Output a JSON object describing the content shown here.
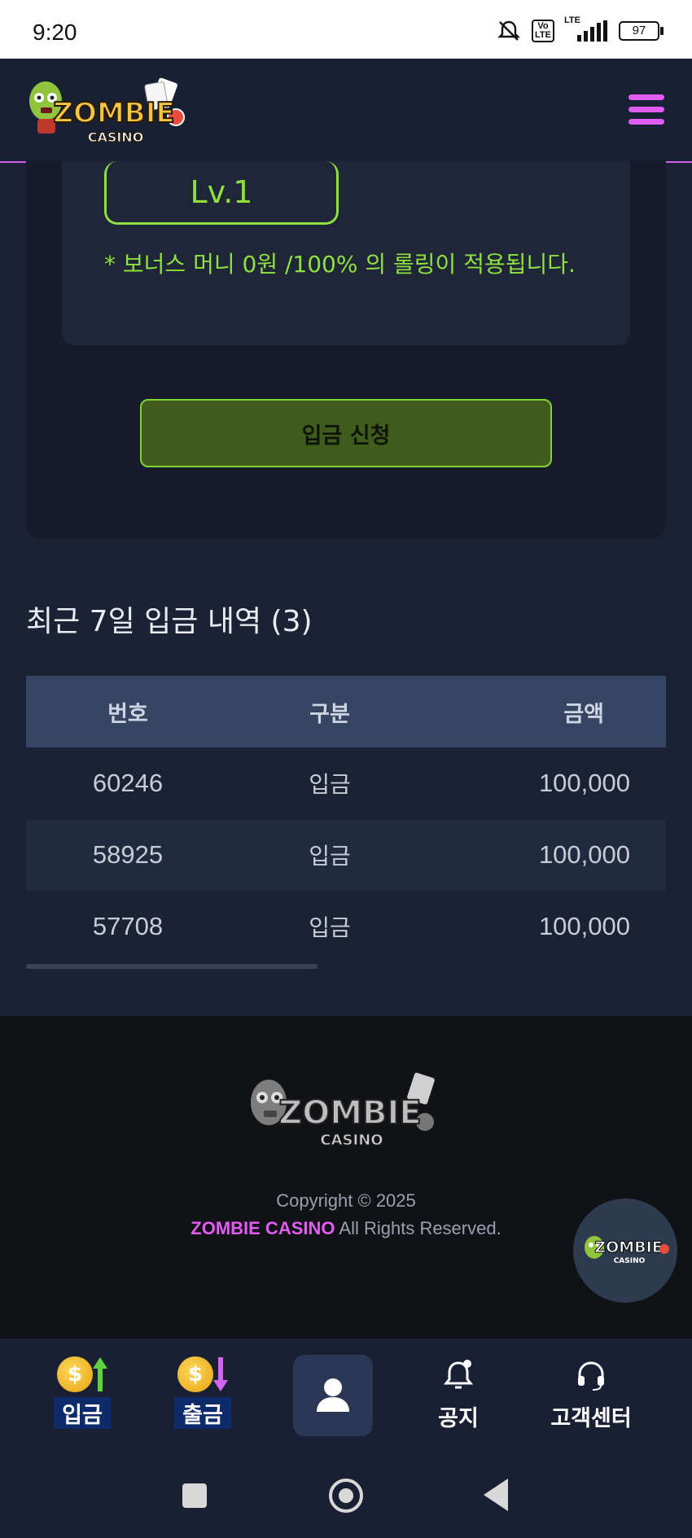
{
  "status_bar": {
    "time": "9:20",
    "network": "LTE",
    "volte": "Vo LTE",
    "battery": "97"
  },
  "header": {
    "logo_text_top": "ZOMBIE",
    "logo_text_bottom": "CASINO"
  },
  "deposit_card": {
    "level": "Lv.1",
    "bonus_note": "* 보너스 머니 0원 /100% 의 롤링이 적용됩니다.",
    "apply_button": "입금 신청"
  },
  "history": {
    "title": "최근 7일 입금 내역 (3)",
    "columns": [
      "번호",
      "구분",
      "금액"
    ],
    "rows": [
      {
        "id": "60246",
        "type": "입금",
        "amount": "100,000"
      },
      {
        "id": "58925",
        "type": "입금",
        "amount": "100,000"
      },
      {
        "id": "57708",
        "type": "입금",
        "amount": "100,000"
      }
    ]
  },
  "footer": {
    "copyright": "Copyright © 2025",
    "brand": "ZOMBIE CASINO",
    "rights": "All Rights Reserved."
  },
  "bottom_nav": {
    "deposit": "입금",
    "withdraw": "출금",
    "notice": "공지",
    "support": "고객센터"
  },
  "colors": {
    "accent_green": "#8fe03f",
    "accent_pink": "#e05cf2",
    "background": "#1b2234"
  }
}
